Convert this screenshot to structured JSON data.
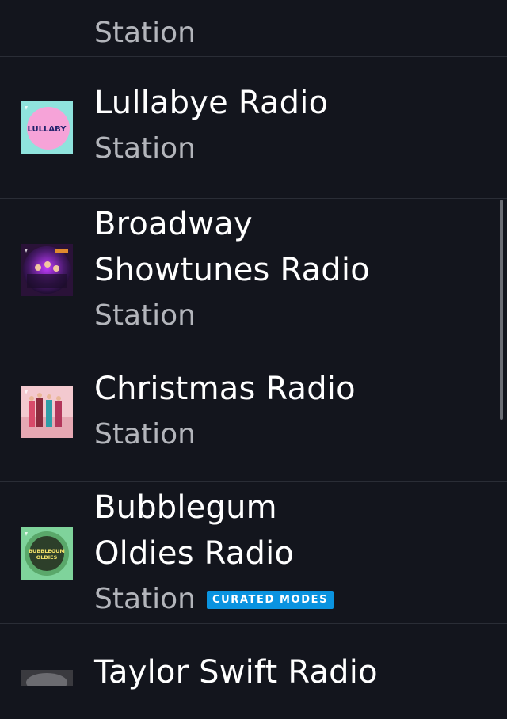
{
  "stations": [
    {
      "title": "",
      "subtitle": "Station",
      "art": "blue-disc-art"
    },
    {
      "title": "Lullabye Radio",
      "subtitle": "Station",
      "art": "lullaby-art",
      "art_text": "LULLABY"
    },
    {
      "title_line1": "Broadway",
      "title_line2": "Showtunes Radio",
      "subtitle": "Station",
      "art": "broadway-art"
    },
    {
      "title": "Christmas Radio",
      "subtitle": "Station",
      "art": "christmas-art"
    },
    {
      "title_line1": "Bubblegum",
      "title_line2": "Oldies Radio",
      "subtitle": "Station",
      "badge": "CURATED MODES",
      "art": "bubblegum-art",
      "art_text_line1": "BUBBLEGUM",
      "art_text_line2": "OLDIES"
    },
    {
      "title": "Taylor Swift Radio",
      "subtitle": "",
      "art": "taylor-art"
    }
  ],
  "colors": {
    "background": "#13151d",
    "divider": "#2a2d36",
    "title": "#ffffff",
    "subtitle": "#b3b5bb",
    "badge": "#0a93e0"
  }
}
